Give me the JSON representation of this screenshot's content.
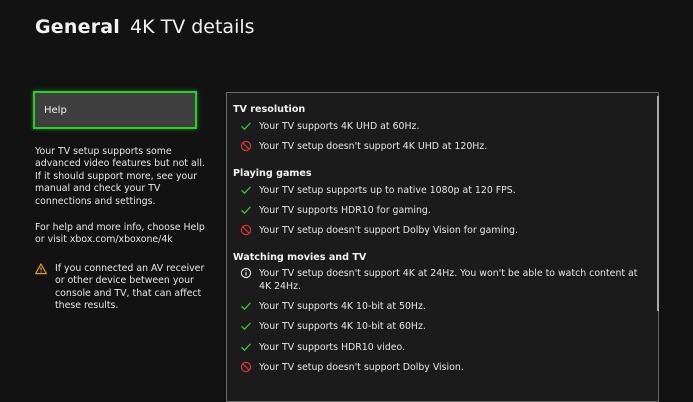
{
  "header": {
    "section": "General",
    "page": "4K TV details"
  },
  "sidebar": {
    "help_label": "Help",
    "paragraph1": "Your TV setup supports some advanced video features but not all. If it should support more, see your manual and check your TV connections and settings.",
    "paragraph2": "For help and more info, choose Help or visit xbox.com/xboxone/4k",
    "warning": "If you connected an AV receiver or other device between your console and TV, that can affect these results."
  },
  "details": {
    "groups": [
      {
        "title": "TV resolution",
        "items": [
          {
            "status": "check-icon",
            "text": "Your TV supports 4K UHD at 60Hz."
          },
          {
            "status": "no-icon",
            "text": "Your TV setup doesn't support 4K UHD at 120Hz."
          }
        ]
      },
      {
        "title": "Playing games",
        "items": [
          {
            "status": "check-icon",
            "text": "Your TV setup supports up to native 1080p at 120 FPS."
          },
          {
            "status": "check-icon",
            "text": "Your TV supports HDR10 for gaming."
          },
          {
            "status": "no-icon",
            "text": "Your TV setup doesn't support Dolby Vision for gaming."
          }
        ]
      },
      {
        "title": "Watching movies and TV",
        "items": [
          {
            "status": "info-icon",
            "text": "Your TV setup doesn't support 4K at 24Hz. You won't be able to watch content at 4K 24Hz."
          },
          {
            "status": "check-icon",
            "text": "Your TV supports 4K 10-bit at 50Hz."
          },
          {
            "status": "check-icon",
            "text": "Your TV supports 4K 10-bit at 60Hz."
          },
          {
            "status": "check-icon",
            "text": "Your TV supports HDR10 video."
          },
          {
            "status": "no-icon",
            "text": "Your TV setup doesn't support Dolby Vision."
          }
        ]
      }
    ]
  },
  "colors": {
    "accent": "#2fcc2f",
    "check": "#2fbf2f",
    "no": "#e0343a",
    "warning": "#e8a000"
  }
}
